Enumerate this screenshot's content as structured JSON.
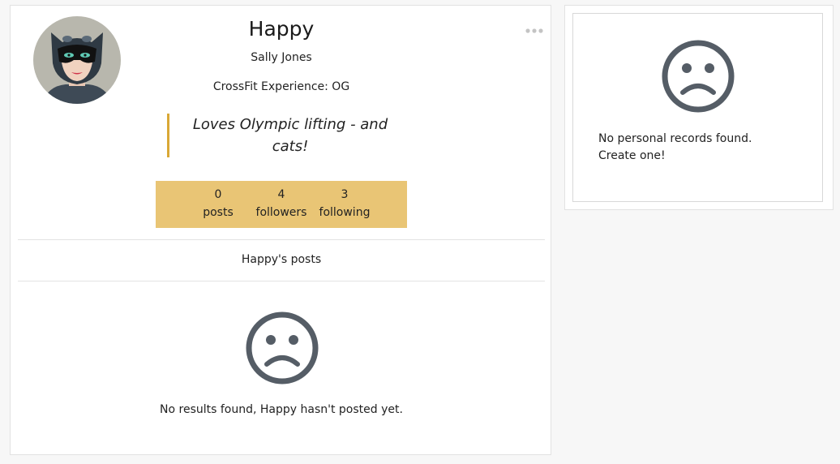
{
  "profile": {
    "username": "Happy",
    "full_name": "Sally Jones",
    "experience_label": "CrossFit Experience:",
    "experience_value": "OG",
    "bio": "Loves Olympic lifting - and cats!",
    "more_icon": "more-horizontal-icon",
    "accent_color": "#e9c575",
    "quote_border_color": "#d9a836"
  },
  "stats": [
    {
      "count": "0",
      "label": "posts"
    },
    {
      "count": "4",
      "label": "followers"
    },
    {
      "count": "3",
      "label": "following"
    }
  ],
  "posts": {
    "heading": "Happy's posts",
    "empty_icon": "sad-face-icon",
    "empty_message": "No results found, Happy hasn't posted yet."
  },
  "records": {
    "empty_icon": "sad-face-icon",
    "empty_message": "No personal records found.",
    "create_link": "Create one!"
  }
}
